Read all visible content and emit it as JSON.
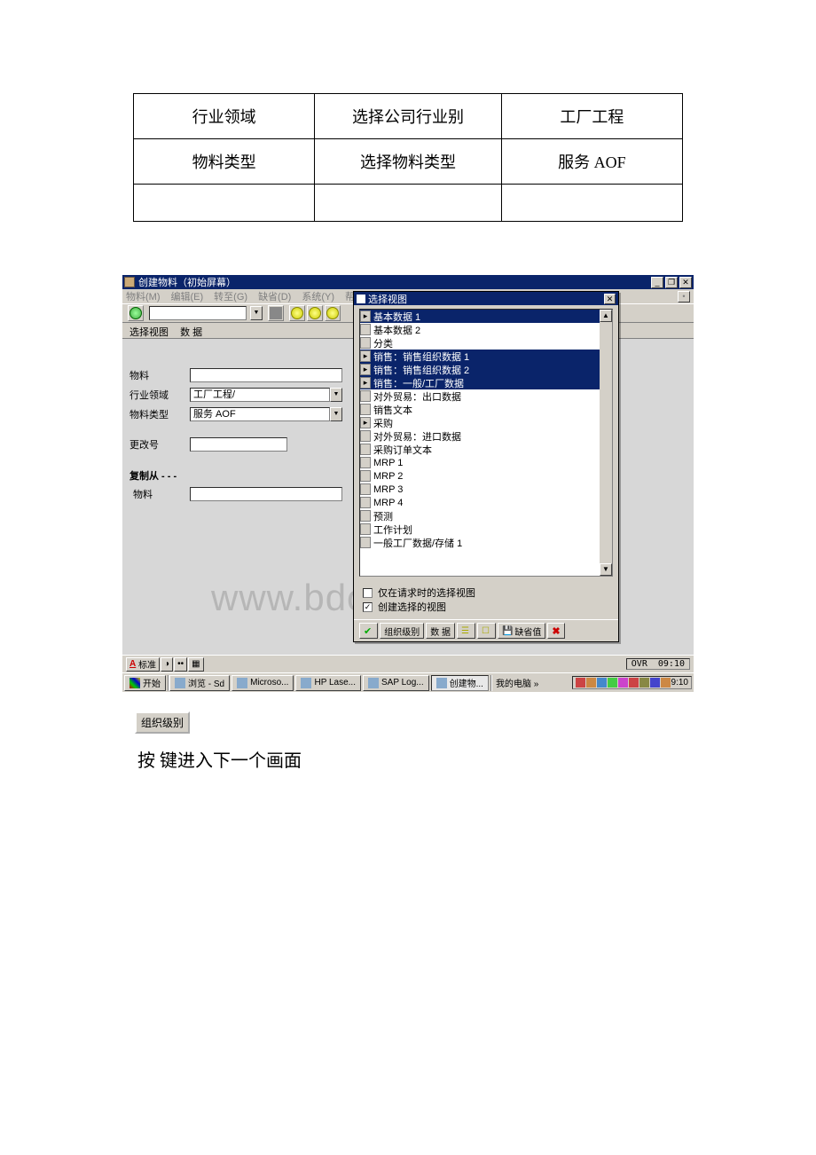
{
  "doc_table": {
    "r1c1": "行业领域",
    "r1c2": "选择公司行业别",
    "r1c3": "工厂工程",
    "r2c1": "物料类型",
    "r2c2": "选择物料类型",
    "r2c3": "服务 AOF",
    "r3c1": "",
    "r3c2": "",
    "r3c3": ""
  },
  "sap": {
    "window_title": "创建物料（初始屏幕）",
    "winbtns": {
      "min": "_",
      "max": "❐",
      "close": "✕"
    },
    "menus": [
      "物料(M)",
      "编辑(E)",
      "转至(G)",
      "缺省(D)",
      "系统(Y)",
      "帮助(H)"
    ],
    "subbar": {
      "a": "选择视图",
      "b": "数 据"
    },
    "form": {
      "material_label": "物料",
      "material_value": "",
      "industry_label": "行业领域",
      "industry_value": "工厂工程/",
      "mtype_label": "物料类型",
      "mtype_value": "服务 AOF",
      "changeno_label": "更改号",
      "changeno_value": "",
      "copy_section": "复制从 - - -",
      "copy_material_label": "物料",
      "copy_material_value": ""
    },
    "dialog": {
      "title": "选择视图",
      "items": [
        {
          "label": "基本数据 1",
          "selected": true,
          "marker": "▸"
        },
        {
          "label": "基本数据 2",
          "selected": false,
          "marker": ""
        },
        {
          "label": "分类",
          "selected": false,
          "marker": ""
        },
        {
          "label": "销售：销售组织数据 1",
          "selected": true,
          "marker": "▸"
        },
        {
          "label": "销售：销售组织数据 2",
          "selected": true,
          "marker": "▸"
        },
        {
          "label": "销售：一般/工厂数据",
          "selected": true,
          "marker": "▸"
        },
        {
          "label": "对外贸易：出口数据",
          "selected": false,
          "marker": ""
        },
        {
          "label": "销售文本",
          "selected": false,
          "marker": ""
        },
        {
          "label": "采购",
          "selected": false,
          "marker": "▸"
        },
        {
          "label": "对外贸易：进口数据",
          "selected": false,
          "marker": ""
        },
        {
          "label": "采购订单文本",
          "selected": false,
          "marker": ""
        },
        {
          "label": "MRP 1",
          "selected": false,
          "marker": ""
        },
        {
          "label": "MRP 2",
          "selected": false,
          "marker": ""
        },
        {
          "label": "MRP 3",
          "selected": false,
          "marker": ""
        },
        {
          "label": "MRP 4",
          "selected": false,
          "marker": ""
        },
        {
          "label": "预测",
          "selected": false,
          "marker": ""
        },
        {
          "label": "工作计划",
          "selected": false,
          "marker": ""
        },
        {
          "label": "一般工厂数据/存储 1",
          "selected": false,
          "marker": ""
        }
      ],
      "check1": "仅在请求时的选择视图",
      "check1_checked": false,
      "check2": "创建选择的视图",
      "check2_checked": true,
      "buttons": {
        "ok": "✔",
        "org": "组织级别",
        "data": "数 据",
        "b1": "",
        "b2": "",
        "default": "缺省值",
        "cancel": "✖"
      }
    },
    "status": {
      "std": "标准",
      "ovr": "OVR",
      "time": "09:10"
    },
    "taskbar": {
      "start": "开始",
      "items": [
        {
          "label": "浏览 - Sd",
          "active": false
        },
        {
          "label": "Microso...",
          "active": false
        },
        {
          "label": "HP Lase...",
          "active": false
        },
        {
          "label": "SAP Log...",
          "active": false
        },
        {
          "label": "创建物...",
          "active": true
        }
      ],
      "mycomputer": "我的电脑 »",
      "clock": "9:10"
    }
  },
  "button_below": "组织级别",
  "instruction": "按    键进入下一个画面",
  "watermark": "www.bdocx.com"
}
